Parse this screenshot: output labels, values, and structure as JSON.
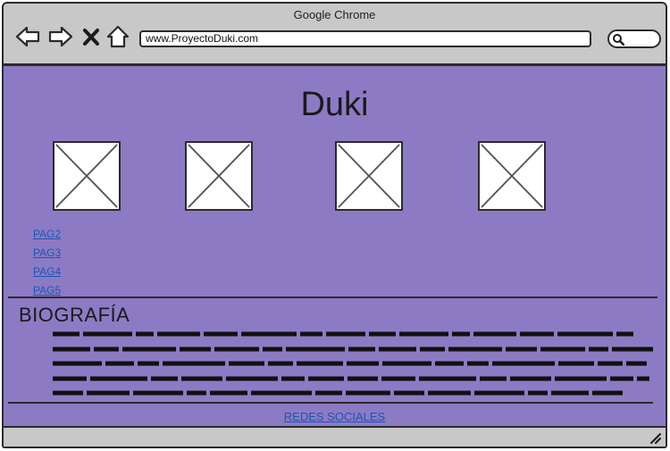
{
  "window": {
    "title": "Google Chrome"
  },
  "toolbar": {
    "url": "www.ProyectoDuki.com",
    "back_icon": "back-arrow-icon",
    "forward_icon": "forward-arrow-icon",
    "close_icon": "close-x-icon",
    "home_icon": "home-icon",
    "search_icon": "search-icon"
  },
  "page": {
    "title": "Duki",
    "images": [
      "image-placeholder-1",
      "image-placeholder-2",
      "image-placeholder-3",
      "image-placeholder-4"
    ],
    "nav_links": [
      "PAG2",
      "PAG3",
      "PAG4",
      "PAG5"
    ],
    "section_heading": "BIOGRAFÍA",
    "footer_link": "REDES SOCIALES"
  },
  "colors": {
    "page_background": "#8c7bc4",
    "chrome": "#c8c8c8",
    "link": "#1a55b5",
    "outline": "#2b2b2b"
  }
}
